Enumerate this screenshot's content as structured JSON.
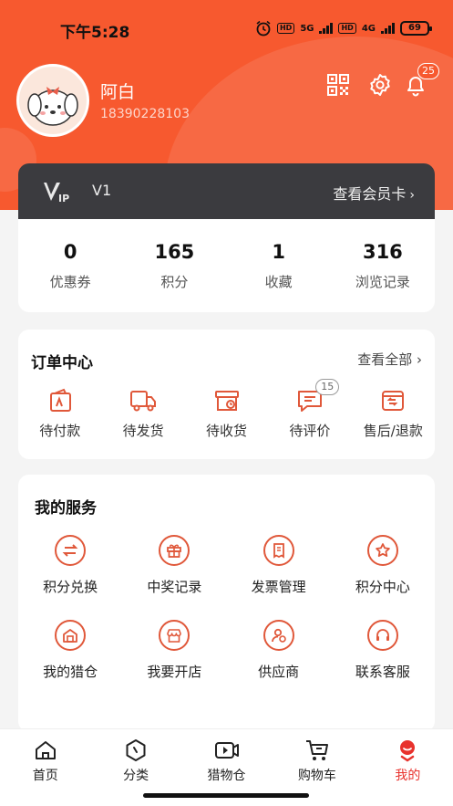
{
  "colors": {
    "brand": "#f7592f",
    "vip_bg": "#3b3b3f",
    "active_tab": "#e8322d",
    "service_icon": "#e0583a"
  },
  "status_bar": {
    "time": "下午5:28",
    "hd1": "HD",
    "net1": "5G",
    "hd2": "HD",
    "net2": "4G",
    "battery": "69"
  },
  "profile": {
    "name": "阿白",
    "phone": "18390228103",
    "avatar_icon": "dog-avatar-icon"
  },
  "header_icons": {
    "qr": "qr-code-icon",
    "settings": "gear-icon",
    "notifications": "bell-icon",
    "notification_count": "25"
  },
  "vip": {
    "level": "V1",
    "link": "查看会员卡"
  },
  "stats": [
    {
      "value": "0",
      "label": "优惠券"
    },
    {
      "value": "165",
      "label": "积分"
    },
    {
      "value": "1",
      "label": "收藏"
    },
    {
      "value": "316",
      "label": "浏览记录"
    }
  ],
  "orders": {
    "title": "订单中心",
    "more": "查看全部",
    "items": [
      {
        "label": "待付款",
        "icon": "wallet-icon"
      },
      {
        "label": "待发货",
        "icon": "truck-icon"
      },
      {
        "label": "待收货",
        "icon": "package-icon"
      },
      {
        "label": "待评价",
        "icon": "comment-icon",
        "badge": "15"
      },
      {
        "label": "售后/退款",
        "icon": "refund-icon"
      }
    ]
  },
  "services": {
    "title": "我的服务",
    "items": [
      {
        "label": "积分兑换",
        "icon": "exchange-icon"
      },
      {
        "label": "中奖记录",
        "icon": "gift-icon"
      },
      {
        "label": "发票管理",
        "icon": "invoice-icon"
      },
      {
        "label": "积分中心",
        "icon": "star-icon"
      },
      {
        "label": "我的猎仓",
        "icon": "warehouse-icon"
      },
      {
        "label": "我要开店",
        "icon": "shop-icon"
      },
      {
        "label": "供应商",
        "icon": "supplier-icon"
      },
      {
        "label": "联系客服",
        "icon": "headset-icon"
      }
    ]
  },
  "tabbar": [
    {
      "label": "首页",
      "icon": "home-icon",
      "active": false
    },
    {
      "label": "分类",
      "icon": "category-icon",
      "active": false
    },
    {
      "label": "猎物仓",
      "icon": "video-icon",
      "active": false
    },
    {
      "label": "购物车",
      "icon": "cart-icon",
      "active": false
    },
    {
      "label": "我的",
      "icon": "profile-icon",
      "active": true
    }
  ]
}
